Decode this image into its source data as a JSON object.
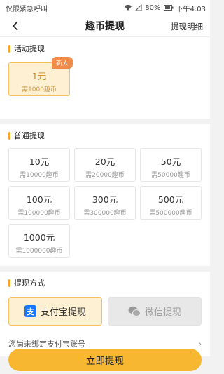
{
  "status_bar": {
    "carrier": "仅限紧急呼叫",
    "battery": "80%",
    "time": "下午4:03"
  },
  "header": {
    "title": "趣币提现",
    "right_link": "提现明细"
  },
  "activity": {
    "title": "活动提现",
    "items": [
      {
        "amount": "1元",
        "cost": "需1000趣币",
        "badge": "新人"
      }
    ]
  },
  "normal": {
    "title": "普通提现",
    "items": [
      {
        "amount": "10元",
        "cost": "需10000趣币"
      },
      {
        "amount": "20元",
        "cost": "需20000趣币"
      },
      {
        "amount": "50元",
        "cost": "需50000趣币"
      },
      {
        "amount": "100元",
        "cost": "需100000趣币"
      },
      {
        "amount": "300元",
        "cost": "需300000趣币"
      },
      {
        "amount": "500元",
        "cost": "需500000趣币"
      },
      {
        "amount": "1000元",
        "cost": "需1000000趣币"
      }
    ]
  },
  "method": {
    "title": "提现方式",
    "alipay_label": "支付宝提现",
    "wechat_label": "微信提现",
    "bind_hint": "您尚未绑定支付宝账号"
  },
  "submit_label": "立即提现",
  "colors": {
    "accent": "#f7b731",
    "badge": "#f08b4a",
    "alipay": "#1677ff"
  }
}
